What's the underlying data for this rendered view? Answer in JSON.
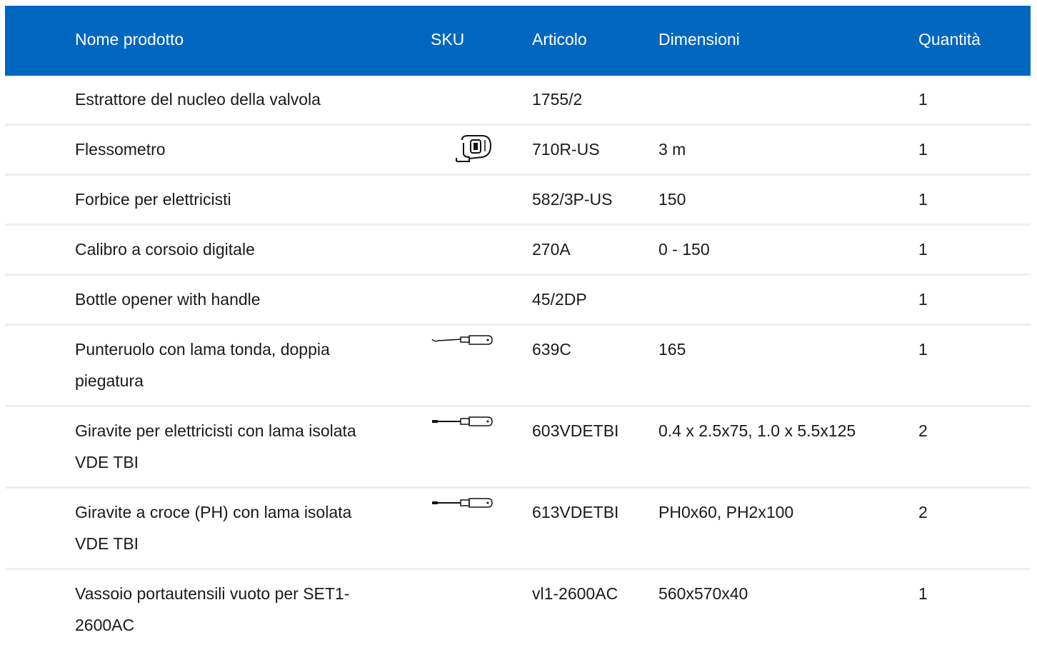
{
  "table": {
    "headers": {
      "name": "Nome prodotto",
      "sku": "SKU",
      "article": "Articolo",
      "dimensions": "Dimensioni",
      "quantity": "Quantità"
    },
    "rows": [
      {
        "name": "Estrattore del nucleo della valvola",
        "article": "1755/2",
        "dimensions": "",
        "quantity": "1",
        "icon": ""
      },
      {
        "name": "Flessometro",
        "article": "710R-US",
        "dimensions": "3 m",
        "quantity": "1",
        "icon": "tape-measure-icon"
      },
      {
        "name": "Forbice per elettricisti",
        "article": "582/3P-US",
        "dimensions": "150",
        "quantity": "1",
        "icon": ""
      },
      {
        "name": "Calibro a corsoio digitale",
        "article": "270A",
        "dimensions": "0 - 150",
        "quantity": "1",
        "icon": ""
      },
      {
        "name": "Bottle opener with handle",
        "article": "45/2DP",
        "dimensions": "",
        "quantity": "1",
        "icon": ""
      },
      {
        "name": "Punteruolo con lama tonda, doppia piegatura",
        "article": "639C",
        "dimensions": "165",
        "quantity": "1",
        "icon": "awl-icon"
      },
      {
        "name": "Giravite per elettricisti con lama isolata VDE TBI",
        "article": "603VDETBI",
        "dimensions": "0.4 x 2.5x75, 1.0 x 5.5x125",
        "quantity": "2",
        "icon": "screwdriver-icon"
      },
      {
        "name": "Giravite a croce (PH) con lama isolata VDE TBI",
        "article": "613VDETBI",
        "dimensions": "PH0x60, PH2x100",
        "quantity": "2",
        "icon": "screwdriver-icon"
      },
      {
        "name": "Vassoio portautensili vuoto per SET1-2600AC",
        "article": "vl1-2600AC",
        "dimensions": "560x570x40",
        "quantity": "1",
        "icon": ""
      }
    ]
  },
  "colors": {
    "header_bg": "#0067c0",
    "header_text": "#ffffff",
    "row_divider": "#efefef"
  }
}
